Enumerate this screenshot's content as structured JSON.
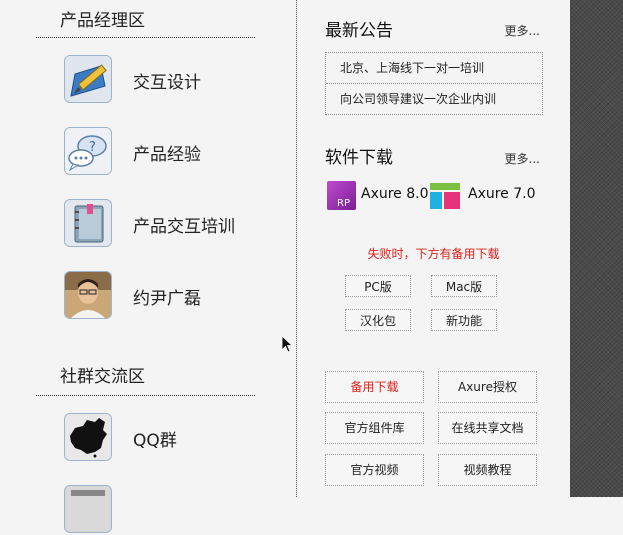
{
  "left": {
    "product_section_title": "产品经理区",
    "product_items": [
      {
        "label": "交互设计",
        "icon": "pencil-ruler-icon"
      },
      {
        "label": "产品经验",
        "icon": "speech-bubbles-icon"
      },
      {
        "label": "产品交互培训",
        "icon": "notebook-icon"
      },
      {
        "label": "约尹广磊",
        "icon": "avatar-photo"
      }
    ],
    "community_section_title": "社群交流区",
    "community_items": [
      {
        "label": "QQ群",
        "icon": "china-map-icon"
      }
    ]
  },
  "announcements": {
    "title": "最新公告",
    "more": "更多...",
    "items": [
      "北京、上海线下一对一培训",
      "向公司领导建议一次企业内训"
    ]
  },
  "downloads": {
    "title": "软件下载",
    "more": "更多...",
    "software": [
      {
        "label": "Axure 8.0",
        "icon": "axure-rp-logo",
        "color": "#9b2fae"
      },
      {
        "label": "Axure 7.0",
        "icon": "axure-7-logo",
        "color": "#e6337a"
      }
    ],
    "fallback_notice": "失败时，下方有备用下载",
    "small_buttons": [
      "PC版",
      "Mac版",
      "汉化包",
      "新功能"
    ],
    "big_buttons": [
      "备用下载",
      "Axure授权",
      "官方组件库",
      "在线共享文档",
      "官方视频",
      "视频教程"
    ]
  },
  "colors": {
    "accent_red": "#e0201b",
    "axure_cyan": "#1fb1e0",
    "axure_green": "#7ac143"
  }
}
